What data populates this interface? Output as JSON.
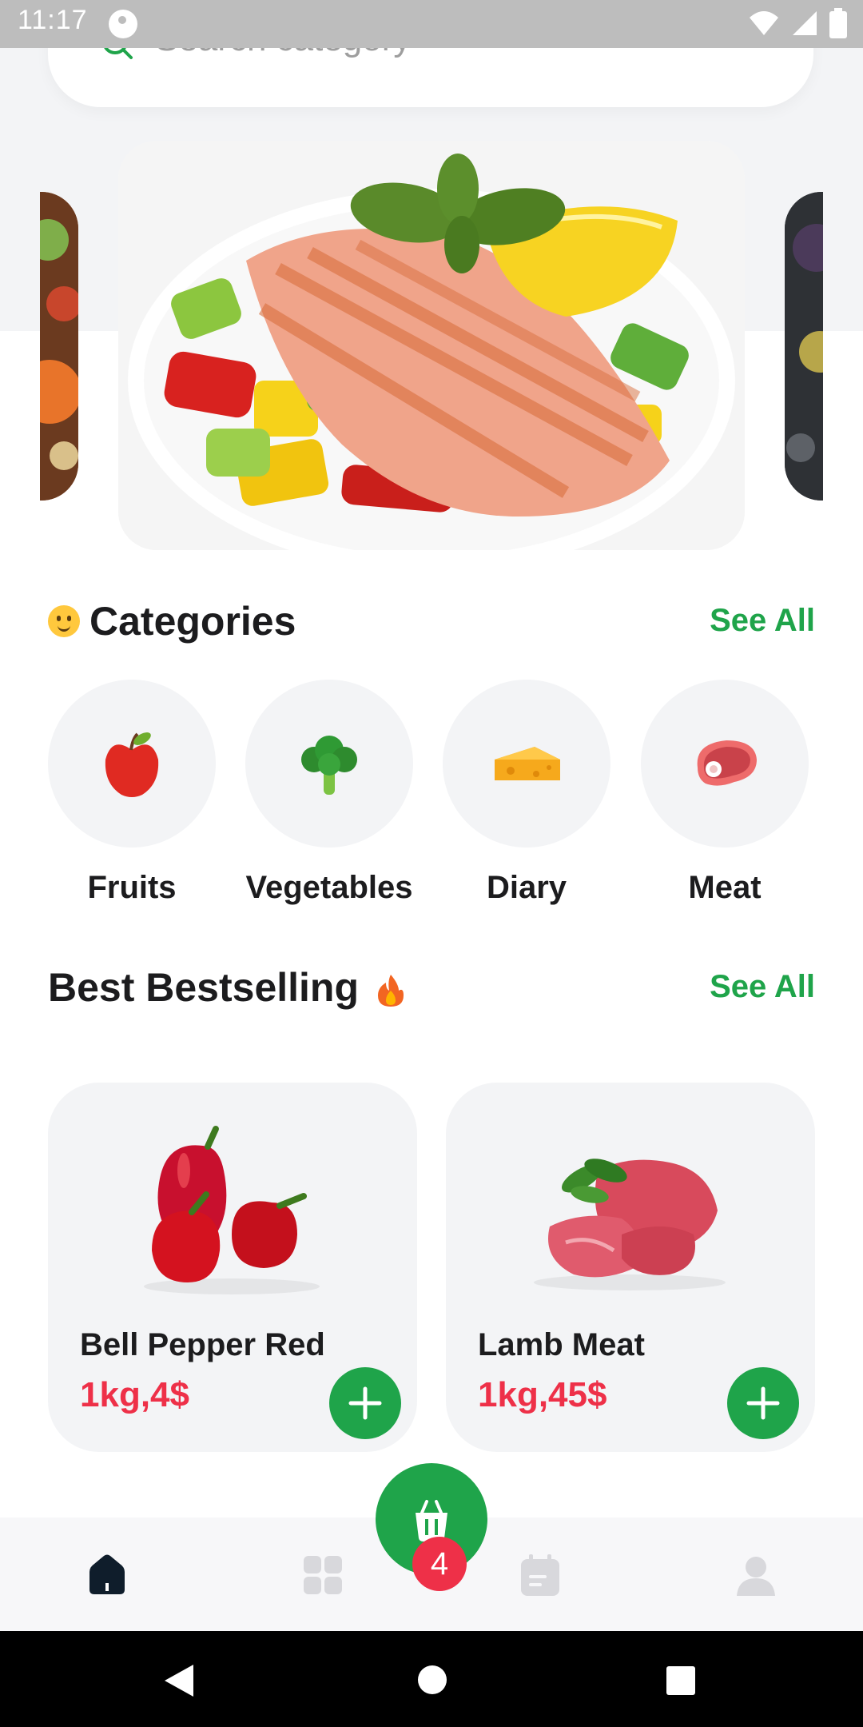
{
  "status_bar": {
    "time": "11:17"
  },
  "search": {
    "placeholder": "Search category"
  },
  "categories_section": {
    "title": "Categories",
    "see_all": "See All"
  },
  "categories": [
    {
      "label": "Fruits",
      "icon": "apple-icon"
    },
    {
      "label": "Vegetables",
      "icon": "broccoli-icon"
    },
    {
      "label": "Diary",
      "icon": "cheese-icon"
    },
    {
      "label": "Meat",
      "icon": "meat-icon"
    }
  ],
  "bestselling_section": {
    "title": "Best Bestselling",
    "see_all": "See All"
  },
  "products": [
    {
      "name": "Bell Pepper Red",
      "price": "1kg,4$",
      "image": "bell-pepper-image"
    },
    {
      "name": "Lamb Meat",
      "price": "1kg,45$",
      "image": "lamb-meat-image"
    }
  ],
  "cart": {
    "count": "4"
  },
  "bottom_nav": [
    "home-icon",
    "grid-icon",
    "cart-icon",
    "calendar-icon",
    "profile-icon"
  ],
  "colors": {
    "accent": "#1fa44a",
    "price": "#ee3048",
    "card_bg": "#f3f4f6"
  }
}
